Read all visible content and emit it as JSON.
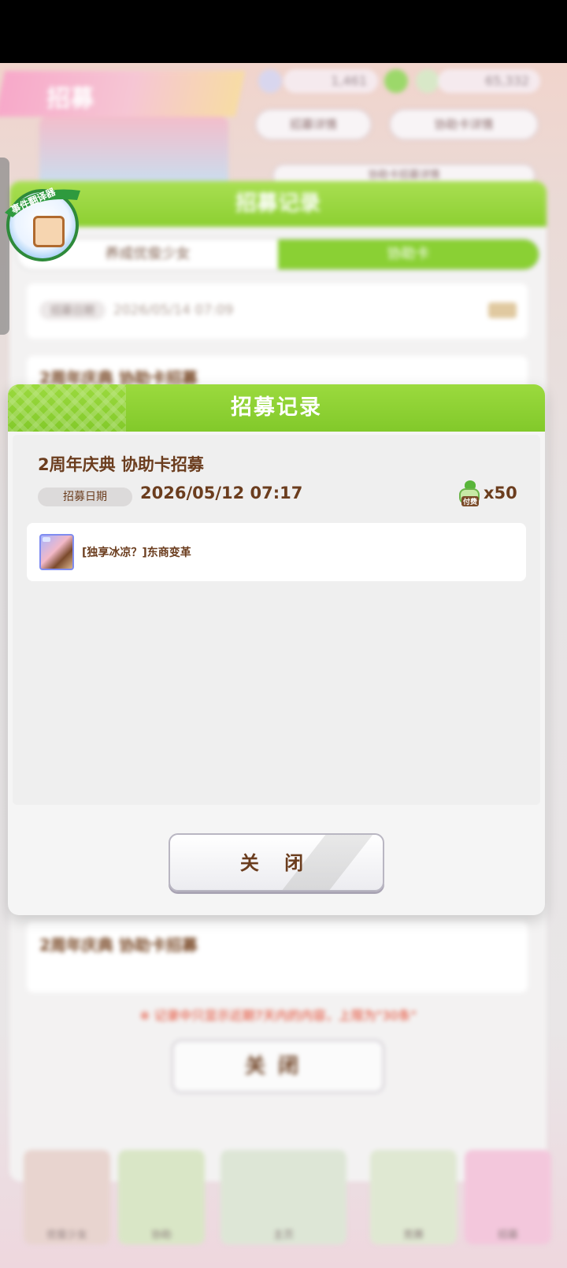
{
  "background": {
    "header_tab": "招募",
    "currency_1": "1,461",
    "currency_2": "65,332",
    "pill_left": "招募详情",
    "pill_right": "协助卡详情",
    "pill_sub": "协助卡招募详情",
    "dialog_title": "招募记录",
    "tabs": [
      "养成优俊少女",
      "协助卡"
    ],
    "records": [
      {
        "title": "",
        "date_label": "招募日期",
        "date": "2026/05/14 07:09"
      },
      {
        "title": "2周年庆典 协助卡招募"
      },
      {
        "title": "2周年庆典 协助卡招募"
      }
    ],
    "notice": "※ 记录中只显示近期7天内的内容，上限为\"30条\"",
    "close_label": "关闭",
    "nav": [
      "优俊少女",
      "协助",
      "主页",
      "竞赛",
      "招募"
    ]
  },
  "translator_badge": {
    "label": "事件翻译器"
  },
  "modal": {
    "title": "招募记录",
    "record_title": "2周年庆典  协助卡招募",
    "date_label": "招募日期",
    "date_value": "2026/05/12  07:17",
    "cost_icon_tag": "付费",
    "cost_value": "x50",
    "card": {
      "icon": "support-card-thumbnail",
      "name": "[独享冰凉？]东商变革"
    },
    "close_label": "关 闭"
  },
  "colors": {
    "header_green": "#8ccf31",
    "text_brown": "#6b3d1e",
    "notice_red": "#e4442b"
  }
}
